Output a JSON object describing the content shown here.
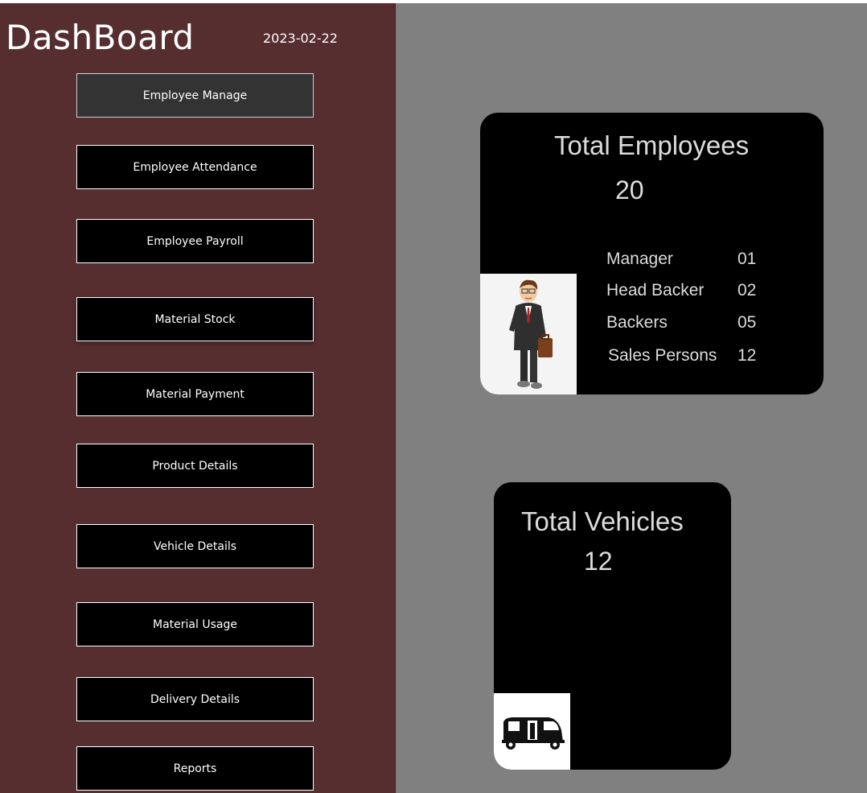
{
  "sidebar": {
    "title": "DashBoard",
    "date": "2023-02-22",
    "items": [
      {
        "label": "Employee Manage"
      },
      {
        "label": "Employee Attendance"
      },
      {
        "label": "Employee Payroll"
      },
      {
        "label": "Material Stock"
      },
      {
        "label": "Material Payment"
      },
      {
        "label": "Product Details"
      },
      {
        "label": "Vehicle Details"
      },
      {
        "label": "Material Usage"
      },
      {
        "label": "Delivery Details"
      },
      {
        "label": "Reports"
      }
    ]
  },
  "employees_card": {
    "title": "Total Employees",
    "count": "20",
    "roles": [
      {
        "name": "Manager",
        "count": "01"
      },
      {
        "name": "Head Backer",
        "count": "02"
      },
      {
        "name": "Backers",
        "count": "05"
      },
      {
        "name": "Sales Persons",
        "count": "12"
      }
    ],
    "image_icon": "businessman-icon"
  },
  "vehicles_card": {
    "title": "Total Vehicles",
    "count": "12",
    "image_icon": "delivery-van-icon"
  },
  "colors": {
    "sidebar_bg": "#562e30",
    "main_bg": "#808080",
    "button_bg": "#000000",
    "button_active_bg": "#333333",
    "card_bg": "#000000",
    "card_text": "#dcdcdc"
  }
}
